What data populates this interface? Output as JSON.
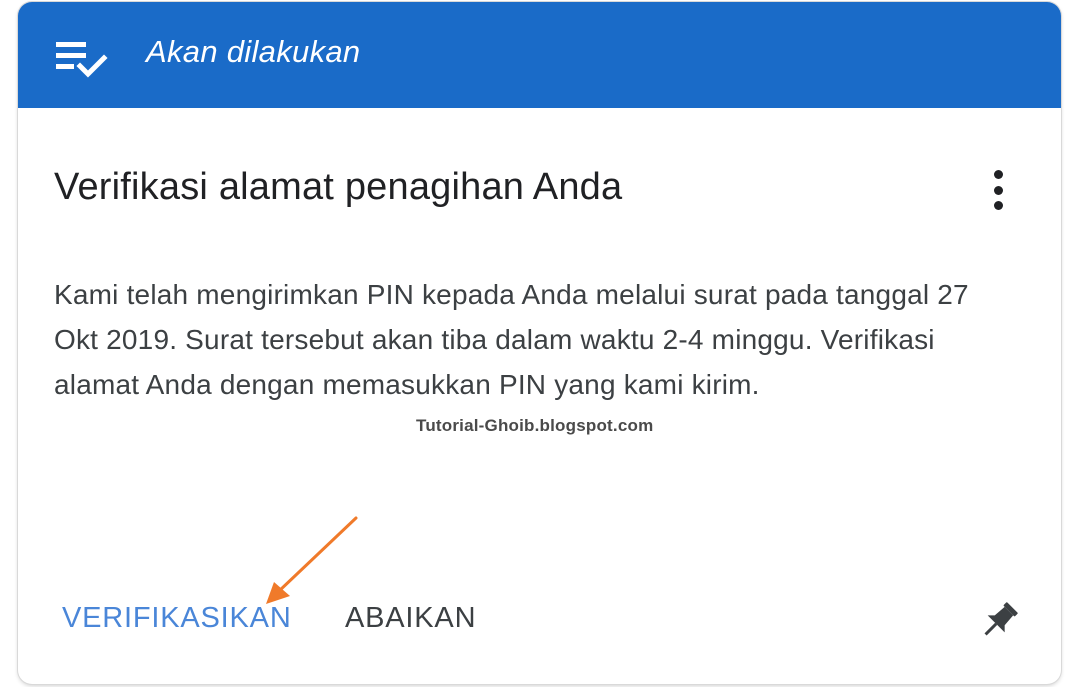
{
  "header": {
    "title": "Akan dilakukan",
    "icon": "checklist-icon",
    "background_color": "#1a6bc8"
  },
  "card": {
    "title": "Verifikasi alamat penagihan Anda",
    "body": "Kami telah mengirimkan PIN kepada Anda melalui surat pada tanggal 27 Okt 2019. Surat tersebut akan tiba dalam waktu 2-4 minggu. Verifikasi alamat Anda dengan memasukkan PIN yang kami kirim.",
    "more_icon": "more-vert-icon"
  },
  "watermark": "Tutorial-Ghoib.blogspot.com",
  "actions": {
    "verify_label": "VERIFIKASIKAN",
    "verify_color": "#4a86d8",
    "ignore_label": "ABAIKAN",
    "pin_icon": "pushpin-icon"
  },
  "annotation": {
    "arrow_color": "#f07a2a"
  }
}
